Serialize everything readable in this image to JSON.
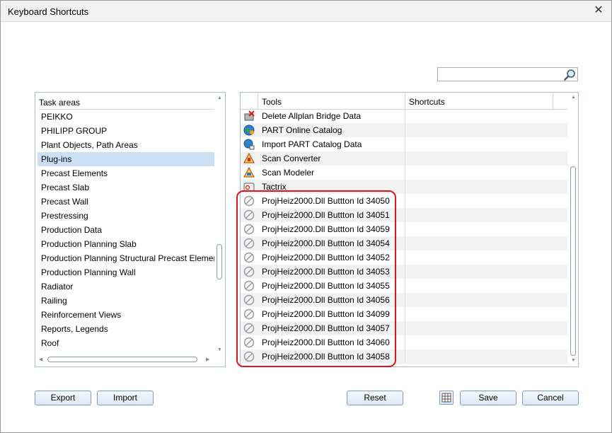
{
  "window": {
    "title": "Keyboard Shortcuts"
  },
  "search": {
    "value": "",
    "placeholder": ""
  },
  "task_areas": {
    "header": "Task areas",
    "items": [
      {
        "label": "PEIKKO",
        "selected": false
      },
      {
        "label": "PHILIPP GROUP",
        "selected": false
      },
      {
        "label": "Plant Objects, Path Areas",
        "selected": false
      },
      {
        "label": "Plug-ins",
        "selected": true
      },
      {
        "label": "Precast Elements",
        "selected": false
      },
      {
        "label": "Precast Slab",
        "selected": false
      },
      {
        "label": "Precast Wall",
        "selected": false
      },
      {
        "label": "Prestressing",
        "selected": false
      },
      {
        "label": "Production Data",
        "selected": false
      },
      {
        "label": "Production Planning Slab",
        "selected": false
      },
      {
        "label": "Production Planning Structural Precast Element",
        "selected": false
      },
      {
        "label": "Production Planning Wall",
        "selected": false
      },
      {
        "label": "Radiator",
        "selected": false
      },
      {
        "label": "Railing",
        "selected": false
      },
      {
        "label": "Reinforcement Views",
        "selected": false
      },
      {
        "label": "Reports, Legends",
        "selected": false
      },
      {
        "label": "Roof",
        "selected": false
      }
    ]
  },
  "tools_grid": {
    "columns": [
      "Tools",
      "Shortcuts"
    ],
    "rows": [
      {
        "icon": "delete-bridge-data-icon",
        "tool": "Delete Allplan Bridge Data",
        "shortcut": ""
      },
      {
        "icon": "globe-catalog-icon",
        "tool": "PART Online Catalog",
        "shortcut": ""
      },
      {
        "icon": "import-catalog-icon",
        "tool": "Import PART Catalog Data",
        "shortcut": ""
      },
      {
        "icon": "scan-converter-icon",
        "tool": "Scan Converter",
        "shortcut": ""
      },
      {
        "icon": "scan-modeler-icon",
        "tool": "Scan Modeler",
        "shortcut": ""
      },
      {
        "icon": "tactrix-icon",
        "tool": "Tactrix",
        "shortcut": ""
      },
      {
        "icon": "disabled-icon",
        "tool": "ProjHeiz2000.Dll Buttton Id 34050",
        "shortcut": ""
      },
      {
        "icon": "disabled-icon",
        "tool": "ProjHeiz2000.Dll Buttton Id 34051",
        "shortcut": ""
      },
      {
        "icon": "disabled-icon",
        "tool": "ProjHeiz2000.Dll Buttton Id 34059",
        "shortcut": ""
      },
      {
        "icon": "disabled-icon",
        "tool": "ProjHeiz2000.Dll Buttton Id 34054",
        "shortcut": ""
      },
      {
        "icon": "disabled-icon",
        "tool": "ProjHeiz2000.Dll Buttton Id 34052",
        "shortcut": ""
      },
      {
        "icon": "disabled-icon",
        "tool": "ProjHeiz2000.Dll Buttton Id 34053",
        "shortcut": ""
      },
      {
        "icon": "disabled-icon",
        "tool": "ProjHeiz2000.Dll Buttton Id 34055",
        "shortcut": ""
      },
      {
        "icon": "disabled-icon",
        "tool": "ProjHeiz2000.Dll Buttton Id 34056",
        "shortcut": ""
      },
      {
        "icon": "disabled-icon",
        "tool": "ProjHeiz2000.Dll Buttton Id 34099",
        "shortcut": ""
      },
      {
        "icon": "disabled-icon",
        "tool": "ProjHeiz2000.Dll Buttton Id 34057",
        "shortcut": ""
      },
      {
        "icon": "disabled-icon",
        "tool": "ProjHeiz2000.Dll Buttton Id 34060",
        "shortcut": ""
      },
      {
        "icon": "disabled-icon",
        "tool": "ProjHeiz2000.Dll Buttton Id 34058",
        "shortcut": ""
      }
    ]
  },
  "buttons": {
    "export": "Export",
    "import": "Import",
    "reset": "Reset",
    "save": "Save",
    "cancel": "Cancel"
  },
  "colors": {
    "selection": "#cce0f5",
    "highlight_annotation": "#e0141e",
    "button_border": "#7a9cc9"
  }
}
